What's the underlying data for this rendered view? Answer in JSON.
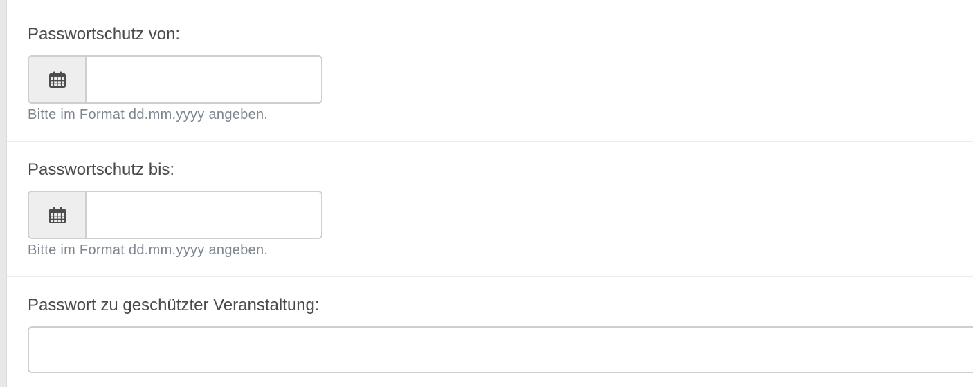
{
  "form": {
    "fields": [
      {
        "label": "Passwortschutz von:",
        "value": "",
        "placeholder": "",
        "icon": "calendar-icon",
        "help": "Bitte im Format dd.mm.yyyy angeben."
      },
      {
        "label": "Passwortschutz bis:",
        "value": "",
        "placeholder": "",
        "icon": "calendar-icon",
        "help": "Bitte im Format dd.mm.yyyy angeben."
      },
      {
        "label": "Passwort zu geschützter Veranstaltung:",
        "value": "",
        "placeholder": ""
      }
    ]
  },
  "colors": {
    "label": "#4a4a4a",
    "help_text": "#7d8590",
    "input_border": "#cfcfcf",
    "addon_background": "#eeeeee",
    "divider": "#ebebeb"
  }
}
